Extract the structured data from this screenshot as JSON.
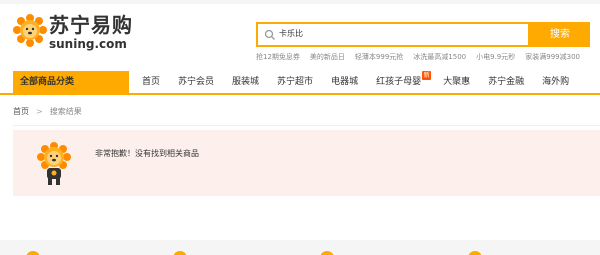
{
  "header": {
    "logo_cn": "苏宁易购",
    "logo_en": "suning.com"
  },
  "search": {
    "query": "卡乐比",
    "button_label": "搜索"
  },
  "hotwords": [
    "抢12期免息券",
    "美的新品日",
    "轻薄本999元抢",
    "冰洗最高减1500",
    "小电9.9元秒",
    "家装满999减300"
  ],
  "nav": {
    "category_label": "全部商品分类",
    "items": [
      {
        "label": "首页"
      },
      {
        "label": "苏宁会员"
      },
      {
        "label": "服装城"
      },
      {
        "label": "苏宁超市"
      },
      {
        "label": "电器城"
      },
      {
        "label": "红孩子母婴",
        "badge": "新"
      },
      {
        "label": "大聚惠"
      },
      {
        "label": "苏宁金融"
      },
      {
        "label": "海外购"
      }
    ]
  },
  "breadcrumb": {
    "home": "首页",
    "separator": ">",
    "current": "搜索结果"
  },
  "empty": {
    "message": "非常抱歉！没有找到相关商品"
  },
  "colors": {
    "accent": "#ffaa00",
    "empty_bg": "#fdf0ec",
    "badge": "#ff5500"
  }
}
